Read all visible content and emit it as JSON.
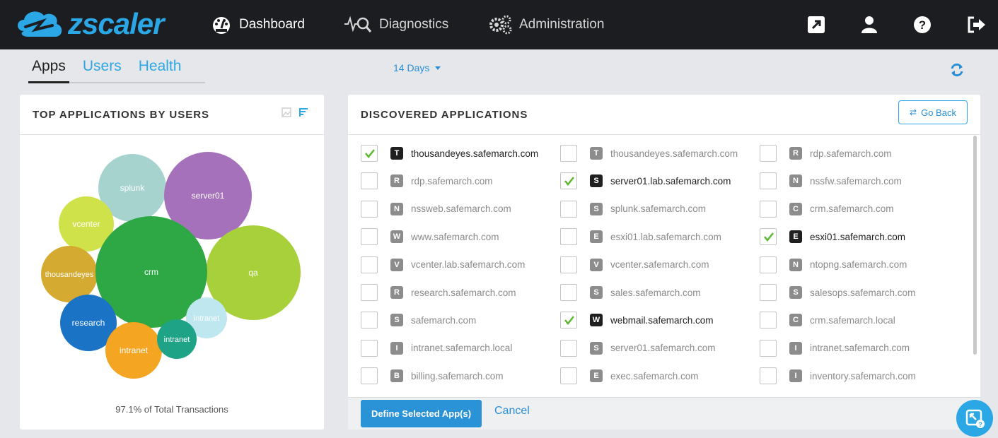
{
  "brand": {
    "name": "zscaler"
  },
  "nav": {
    "dashboard": "Dashboard",
    "diagnostics": "Diagnostics",
    "administration": "Administration"
  },
  "tabs": [
    {
      "label": "Apps",
      "active": true
    },
    {
      "label": "Users",
      "active": false
    },
    {
      "label": "Health",
      "active": false
    }
  ],
  "range": {
    "label": "14 Days"
  },
  "left_panel": {
    "title": "TOP APPLICATIONS BY USERS",
    "footer": "97.1% of Total Transactions",
    "bubbles": [
      {
        "label": "splunk",
        "color": "#a7d3cf"
      },
      {
        "label": "server01",
        "color": "#a571bb"
      },
      {
        "label": "vcenter",
        "color": "#cfe24a"
      },
      {
        "label": "qa",
        "color": "#a8d03a"
      },
      {
        "label": "thousandeyes",
        "color": "#d5aa30"
      },
      {
        "label": "crm",
        "color": "#2ea845"
      },
      {
        "label": "research",
        "color": "#1a73c4"
      },
      {
        "label": "intranet",
        "color": "#bfe7ef"
      },
      {
        "label": "intranet",
        "color": "#f4a521"
      },
      {
        "label": "intranet",
        "color": "#1ea386"
      }
    ]
  },
  "right_panel": {
    "title": "DISCOVERED APPLICATIONS",
    "go_back": "Go Back",
    "define_button": "Define Selected App(s)",
    "cancel": "Cancel",
    "columns": [
      [
        {
          "letter": "T",
          "name": "thousandeyes.safemarch.com",
          "checked": true
        },
        {
          "letter": "R",
          "name": "rdp.safemarch.com",
          "checked": false
        },
        {
          "letter": "N",
          "name": "nssweb.safemarch.com",
          "checked": false
        },
        {
          "letter": "W",
          "name": "www.safemarch.com",
          "checked": false
        },
        {
          "letter": "V",
          "name": "vcenter.lab.safemarch.com",
          "checked": false
        },
        {
          "letter": "R",
          "name": "research.safemarch.com",
          "checked": false
        },
        {
          "letter": "S",
          "name": "safemarch.com",
          "checked": false
        },
        {
          "letter": "I",
          "name": "intranet.safemarch.local",
          "checked": false
        },
        {
          "letter": "B",
          "name": "billing.safemarch.com",
          "checked": false
        }
      ],
      [
        {
          "letter": "T",
          "name": "thousandeyes.safemarch.com",
          "checked": false
        },
        {
          "letter": "S",
          "name": "server01.lab.safemarch.com",
          "checked": true
        },
        {
          "letter": "S",
          "name": "splunk.safemarch.com",
          "checked": false
        },
        {
          "letter": "E",
          "name": "esxi01.lab.safemarch.com",
          "checked": false
        },
        {
          "letter": "V",
          "name": "vcenter.safemarch.com",
          "checked": false
        },
        {
          "letter": "S",
          "name": "sales.safemarch.com",
          "checked": false
        },
        {
          "letter": "W",
          "name": "webmail.safemarch.com",
          "checked": true
        },
        {
          "letter": "S",
          "name": "server01.safemarch.com",
          "checked": false
        },
        {
          "letter": "E",
          "name": "exec.safemarch.com",
          "checked": false
        }
      ],
      [
        {
          "letter": "R",
          "name": "rdp.safemarch.com",
          "checked": false
        },
        {
          "letter": "N",
          "name": "nssfw.safemarch.com",
          "checked": false
        },
        {
          "letter": "C",
          "name": "crm.safemarch.com",
          "checked": false
        },
        {
          "letter": "E",
          "name": "esxi01.safemarch.com",
          "checked": true
        },
        {
          "letter": "N",
          "name": "ntopng.safemarch.com",
          "checked": false
        },
        {
          "letter": "S",
          "name": "salesops.safemarch.com",
          "checked": false
        },
        {
          "letter": "C",
          "name": "crm.safemarch.local",
          "checked": false
        },
        {
          "letter": "I",
          "name": "intranet.safemarch.com",
          "checked": false
        },
        {
          "letter": "I",
          "name": "inventory.safemarch.com",
          "checked": false
        }
      ]
    ]
  },
  "colors": {
    "accent": "#2aa7e4",
    "nav_bg": "#1c1d20",
    "check": "#5cb82e"
  }
}
